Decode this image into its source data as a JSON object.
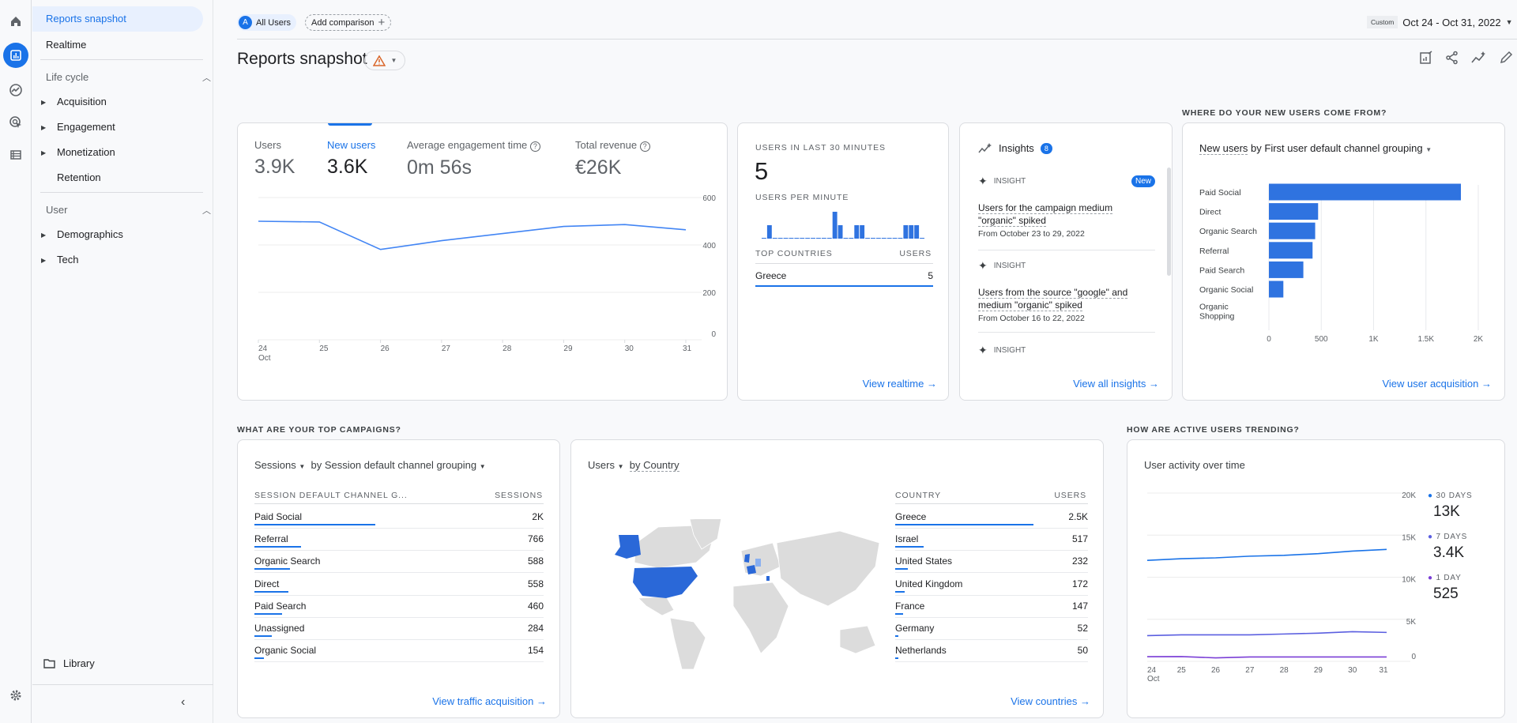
{
  "rail": {
    "icons": [
      "home-icon",
      "reports-icon",
      "explore-icon",
      "advertising-icon",
      "configure-icon",
      "settings-icon"
    ]
  },
  "nav": {
    "active": "Reports snapshot",
    "realtime": "Realtime",
    "lifecycle": {
      "title": "Life cycle",
      "items": [
        "Acquisition",
        "Engagement",
        "Monetization",
        "Retention"
      ]
    },
    "user": {
      "title": "User",
      "items": [
        "Demographics",
        "Tech"
      ]
    },
    "library": "Library"
  },
  "topbar": {
    "segment_badge": "A",
    "segment": "All Users",
    "add_comparison": "Add comparison",
    "date_tag": "Custom",
    "date_range": "Oct 24 - Oct 31, 2022"
  },
  "page": {
    "title": "Reports snapshot"
  },
  "colors": {
    "accent": "#1a73e8",
    "bar": "#2f73e0",
    "line7": "#5b5fe0",
    "line1": "#7b3fd6",
    "warning": "#e37400"
  },
  "overview": {
    "metrics": [
      {
        "label": "Users",
        "value": "3.9K"
      },
      {
        "label": "New users",
        "value": "3.6K",
        "active": true
      },
      {
        "label": "Average engagement time",
        "value": "0m 56s"
      },
      {
        "label": "Total revenue",
        "value": "€26K"
      }
    ]
  },
  "realtime": {
    "title": "USERS IN LAST 30 MINUTES",
    "value": "5",
    "per_minute_label": "USERS PER MINUTE",
    "countries_header": "TOP COUNTRIES",
    "users_header": "USERS",
    "countries": [
      {
        "name": "Greece",
        "value": "5"
      }
    ],
    "link": "View realtime"
  },
  "insights": {
    "title": "Insights",
    "count": "8",
    "items": [
      {
        "label": "INSIGHT",
        "badge": "New",
        "title_1": "Users for the campaign medium",
        "title_2": "\"organic\" spiked",
        "date": "From October 23 to 29, 2022"
      },
      {
        "label": "INSIGHT",
        "title_1": "Users from the source \"google\" and",
        "title_2": "medium \"organic\" spiked",
        "date": "From October 16 to 22, 2022"
      },
      {
        "label": "INSIGHT"
      }
    ],
    "link": "View all insights"
  },
  "new_users_section": {
    "heading": "WHERE DO YOUR NEW USERS COME FROM?",
    "metric": "New users",
    "dimension": "by First user default channel grouping",
    "link": "View user acquisition"
  },
  "campaigns": {
    "heading": "WHAT ARE YOUR TOP CAMPAIGNS?",
    "metric": "Sessions",
    "dimension": "by Session default channel grouping",
    "col1": "SESSION DEFAULT CHANNEL G...",
    "col2": "SESSIONS",
    "rows": [
      {
        "name": "Paid Social",
        "value": "2K",
        "n": 2000
      },
      {
        "name": "Referral",
        "value": "766",
        "n": 766
      },
      {
        "name": "Organic Search",
        "value": "588",
        "n": 588
      },
      {
        "name": "Direct",
        "value": "558",
        "n": 558
      },
      {
        "name": "Paid Search",
        "value": "460",
        "n": 460
      },
      {
        "name": "Unassigned",
        "value": "284",
        "n": 284
      },
      {
        "name": "Organic Social",
        "value": "154",
        "n": 154
      }
    ],
    "link": "View traffic acquisition"
  },
  "countries": {
    "metric": "Users",
    "dimension": "by Country",
    "col1": "COUNTRY",
    "col2": "USERS",
    "rows": [
      {
        "name": "Greece",
        "value": "2.5K",
        "n": 2500
      },
      {
        "name": "Israel",
        "value": "517",
        "n": 517
      },
      {
        "name": "United States",
        "value": "232",
        "n": 232
      },
      {
        "name": "United Kingdom",
        "value": "172",
        "n": 172
      },
      {
        "name": "France",
        "value": "147",
        "n": 147
      },
      {
        "name": "Germany",
        "value": "52",
        "n": 52
      },
      {
        "name": "Netherlands",
        "value": "50",
        "n": 50
      }
    ],
    "link": "View countries"
  },
  "active_users": {
    "heading": "HOW ARE ACTIVE USERS TRENDING?",
    "title": "User activity over time",
    "legend": [
      {
        "label": "30 DAYS",
        "value": "13K"
      },
      {
        "label": "7 DAYS",
        "value": "3.4K"
      },
      {
        "label": "1 DAY",
        "value": "525"
      }
    ]
  },
  "chart_data": [
    {
      "id": "new-users-trend",
      "type": "line",
      "x": [
        "24",
        "25",
        "26",
        "27",
        "28",
        "29",
        "30",
        "31"
      ],
      "x_sublabel": "Oct",
      "series": [
        {
          "values": [
            500,
            497,
            381,
            418,
            448,
            478,
            486,
            464
          ]
        }
      ],
      "yticks": [
        "0",
        "200",
        "400",
        "600"
      ],
      "ylim": [
        0,
        600
      ],
      "grid": true
    },
    {
      "id": "users-per-minute",
      "type": "bar",
      "values": [
        0,
        1,
        0,
        0,
        0,
        0,
        0,
        0,
        0,
        0,
        0,
        0,
        0,
        2,
        1,
        0,
        0,
        1,
        1,
        0,
        0,
        0,
        0,
        0,
        0,
        0,
        1,
        1,
        1,
        0
      ]
    },
    {
      "id": "new-users-by-channel",
      "type": "bar",
      "orientation": "horizontal",
      "categories": [
        "Paid Social",
        "Direct",
        "Organic Search",
        "Referral",
        "Paid Search",
        "Organic Social",
        "Organic Shopping"
      ],
      "values": [
        1834,
        470,
        442,
        417,
        329,
        138,
        0
      ],
      "xticks": [
        "0",
        "500",
        "1K",
        "1.5K",
        "2K"
      ],
      "xlim": [
        0,
        2000
      ],
      "grid": true
    },
    {
      "id": "user-activity",
      "type": "line",
      "x": [
        "24",
        "25",
        "26",
        "27",
        "28",
        "29",
        "30",
        "31"
      ],
      "x_sublabel": "Oct",
      "series": [
        {
          "name": "30 DAYS",
          "values": [
            12000,
            12200,
            12300,
            12500,
            12600,
            12800,
            13100,
            13300
          ]
        },
        {
          "name": "7 DAYS",
          "values": [
            3060,
            3150,
            3150,
            3150,
            3250,
            3350,
            3530,
            3440
          ]
        },
        {
          "name": "1 DAY",
          "values": [
            560,
            570,
            420,
            520,
            520,
            520,
            520,
            525
          ]
        }
      ],
      "yticks": [
        "0",
        "5K",
        "10K",
        "15K",
        "20K"
      ],
      "ylim": [
        0,
        20000
      ],
      "grid": true,
      "legend": "right"
    }
  ]
}
